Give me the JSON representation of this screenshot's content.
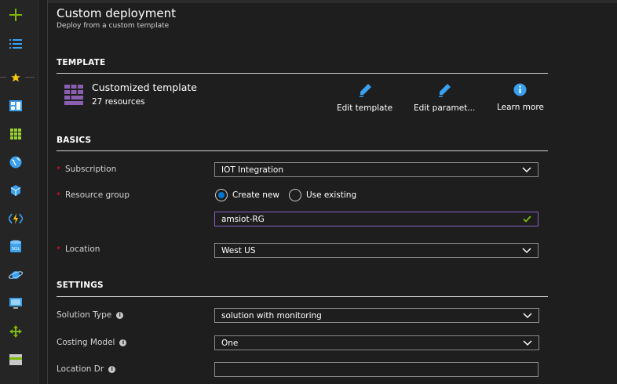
{
  "sidebar": {
    "items": [
      {
        "icon": "plus-icon"
      },
      {
        "icon": "list-icon"
      },
      {
        "icon": "star-icon"
      },
      {
        "icon": "dashboard-icon"
      },
      {
        "icon": "all-resources-grid-icon"
      },
      {
        "icon": "globe-icon"
      },
      {
        "icon": "cube-icon"
      },
      {
        "icon": "function-app-icon"
      },
      {
        "icon": "sql-database-icon"
      },
      {
        "icon": "cosmos-planet-icon"
      },
      {
        "icon": "virtual-machine-icon"
      },
      {
        "icon": "load-balancer-icon"
      },
      {
        "icon": "storage-icon"
      }
    ]
  },
  "header": {
    "title": "Custom deployment",
    "subtitle": "Deploy from a custom template"
  },
  "template": {
    "section_title": "TEMPLATE",
    "name": "Customized template",
    "resources": "27 resources",
    "actions": {
      "edit_template": "Edit template",
      "edit_parameters": "Edit paramet...",
      "learn_more": "Learn more"
    }
  },
  "basics": {
    "section_title": "BASICS",
    "subscription": {
      "label": "Subscription",
      "value": "IOT Integration"
    },
    "resource_group": {
      "label": "Resource group",
      "option_create": "Create new",
      "option_existing": "Use existing",
      "selected": "Create new",
      "value": "amsiot-RG"
    },
    "location": {
      "label": "Location",
      "value": "West US"
    }
  },
  "settings": {
    "section_title": "SETTINGS",
    "solution_type": {
      "label": "Solution Type",
      "value": "solution with monitoring"
    },
    "costing_model": {
      "label": "Costing Model",
      "value": "One"
    },
    "location_dr": {
      "label": "Location Dr",
      "value": ""
    }
  },
  "colors": {
    "accent_blue": "#0078d4",
    "required_red": "#e81123",
    "valid_green": "#7fba00",
    "purple_focus": "#8661c5"
  }
}
